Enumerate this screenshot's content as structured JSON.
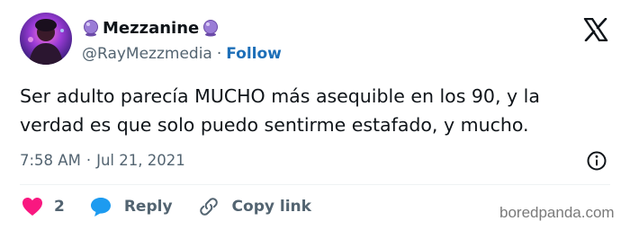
{
  "author": {
    "display_name": "Mezzanine",
    "handle": "@RayMezzmedia",
    "follow_label": "Follow",
    "name_emoji_icon": "crystal-ball-icon"
  },
  "separator": "·",
  "tweet": {
    "lines": [
      "Ser adulto parecía MUCHO más asequible en los 90, y la",
      "verdad es que solo puedo sentirme estafado, y mucho."
    ],
    "time": "7:58 AM",
    "date": "Jul 21, 2021"
  },
  "actions": {
    "like_count": "2",
    "reply_label": "Reply",
    "copy_link_label": "Copy link"
  },
  "watermark": "boredpanda.com",
  "colors": {
    "link": "#1d6fb8",
    "like": "#f91880",
    "reply": "#1d9bf0",
    "muted": "#536471",
    "text": "#0f1419"
  }
}
